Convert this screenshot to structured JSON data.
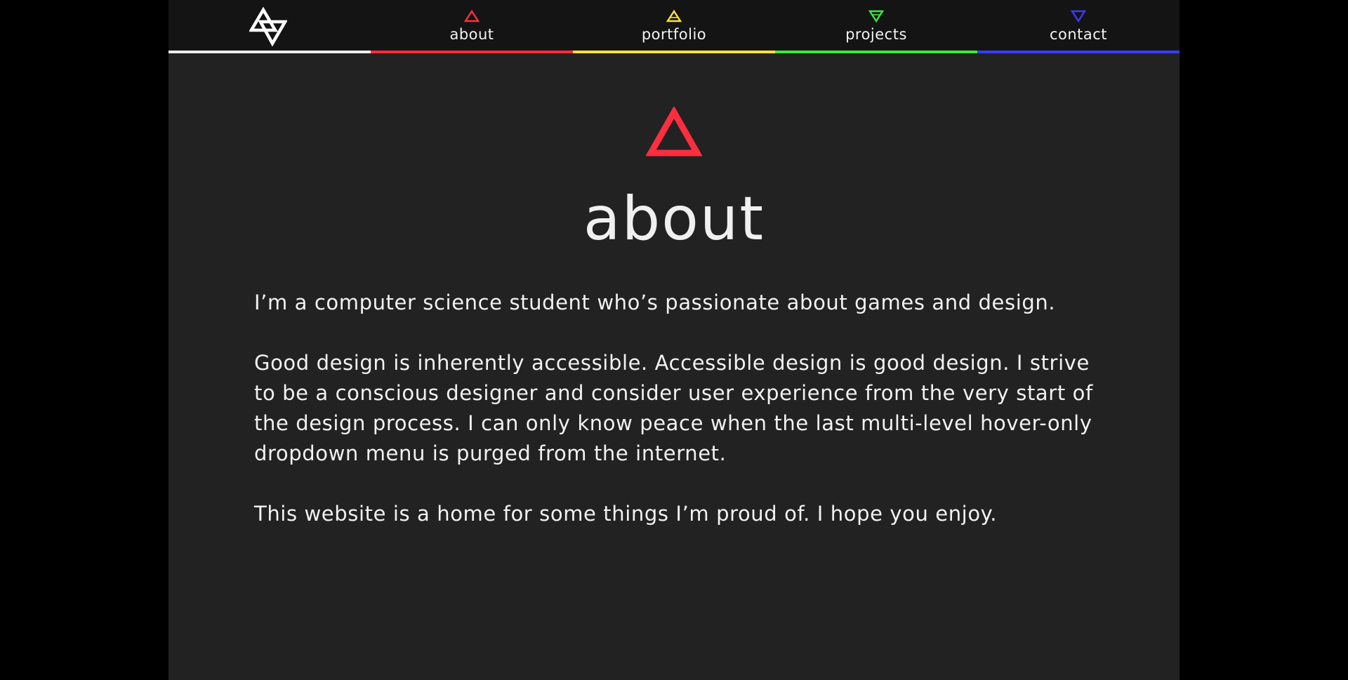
{
  "colors": {
    "page_background": "#000000",
    "site_background": "#222222",
    "navbar_background": "#141414",
    "text": "#f2f2f2",
    "about_accent": "#ff2e3f",
    "portfolio_accent": "#ffe23a",
    "projects_accent": "#3de83d",
    "contact_accent": "#3b3bff",
    "logo_accent": "#eeeeee"
  },
  "nav": {
    "logo_icon": "interlocked-triangles-logo-icon",
    "items": [
      {
        "label": "about",
        "icon": "triangle-up-icon",
        "color": "#ff2e3f"
      },
      {
        "label": "portfolio",
        "icon": "triangle-up-icon",
        "color": "#ffe23a"
      },
      {
        "label": "projects",
        "icon": "triangle-down-icon",
        "color": "#3de83d"
      },
      {
        "label": "contact",
        "icon": "triangle-down-icon",
        "color": "#3b3bff"
      }
    ]
  },
  "main": {
    "hero_icon": "triangle-up-icon",
    "title": "about",
    "paragraphs": [
      "I’m a computer science student who’s passionate about games and design.",
      "Good design is inherently accessible. Accessible design is good design. I strive to be a conscious designer and consider user experience from the very start of the design process. I can only know peace when the last multi-level hover-only dropdown menu is purged from the internet.",
      "This website is a home for some things I’m proud of. I hope you enjoy."
    ]
  }
}
